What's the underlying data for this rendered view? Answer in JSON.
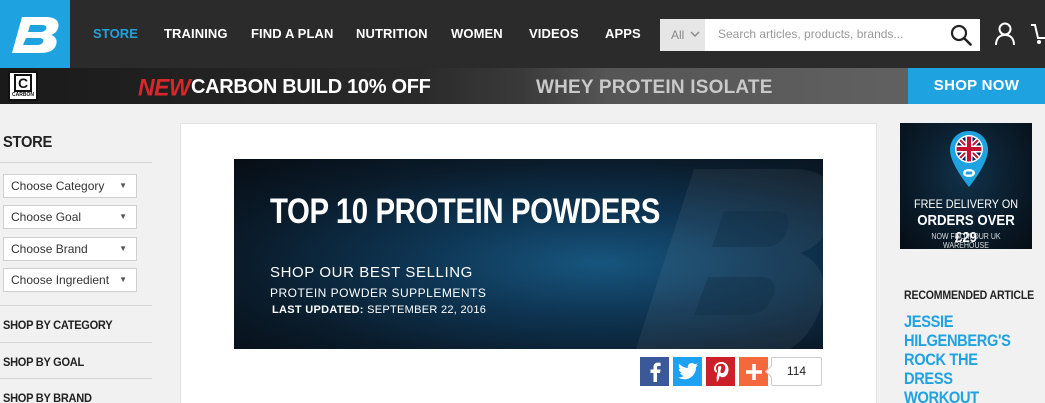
{
  "header": {
    "nav": [
      {
        "label": "STORE",
        "active": true
      },
      {
        "label": "TRAINING",
        "active": false
      },
      {
        "label": "FIND A PLAN",
        "active": false
      },
      {
        "label": "NUTRITION",
        "active": false
      },
      {
        "label": "WOMEN",
        "active": false
      },
      {
        "label": "VIDEOS",
        "active": false
      },
      {
        "label": "APPS",
        "active": false
      }
    ],
    "search": {
      "scope": "All",
      "placeholder": "Search articles, products, brands..."
    },
    "icons": {
      "logo": "bodybuilding-b-logo-icon",
      "search": "magnifier-icon",
      "account": "user-icon",
      "cart": "cart-icon"
    },
    "accent_color": "#1fa3e0"
  },
  "promo": {
    "brand_logo_letter": "C",
    "brand_logo_text": "CARBON",
    "new_label": "NEW",
    "headline": "CARBON BUILD 10% OFF",
    "subline": "WHEY PROTEIN ISOLATE",
    "cta": "SHOP NOW",
    "new_color": "#d8262b"
  },
  "sidebar": {
    "title": "STORE",
    "selects": [
      {
        "value": "Choose Category"
      },
      {
        "value": "Choose Goal"
      },
      {
        "value": "Choose Brand"
      },
      {
        "value": "Choose Ingredient"
      }
    ],
    "links": [
      {
        "label": "SHOP BY CATEGORY"
      },
      {
        "label": "SHOP BY GOAL"
      },
      {
        "label": "SHOP BY BRAND"
      }
    ]
  },
  "hero": {
    "title": "TOP 10 PROTEIN POWDERS",
    "line1": "SHOP OUR BEST SELLING",
    "line2": "PROTEIN POWDER SUPPLEMENTS",
    "updated_label": "LAST UPDATED:",
    "updated_date": "SEPTEMBER 22, 2016"
  },
  "share": {
    "buttons": [
      {
        "network": "facebook",
        "icon": "facebook-icon",
        "color": "#3b5998"
      },
      {
        "network": "twitter",
        "icon": "twitter-icon",
        "color": "#1da1f2"
      },
      {
        "network": "pinterest",
        "icon": "pinterest-icon",
        "color": "#cb2027"
      },
      {
        "network": "more",
        "icon": "plus-icon",
        "color": "#f4683c"
      }
    ],
    "count": "114"
  },
  "ad": {
    "icon": "uk-flag-pin-icon",
    "line1": "FREE DELIVERY ON",
    "line2": "ORDERS OVER £29",
    "line3": "NOW FROM OUR UK WAREHOUSE"
  },
  "recommended": {
    "label": "RECOMMENDED ARTICLE",
    "title": "JESSIE HILGENBERG'S ROCK THE DRESS WORKOUT"
  }
}
